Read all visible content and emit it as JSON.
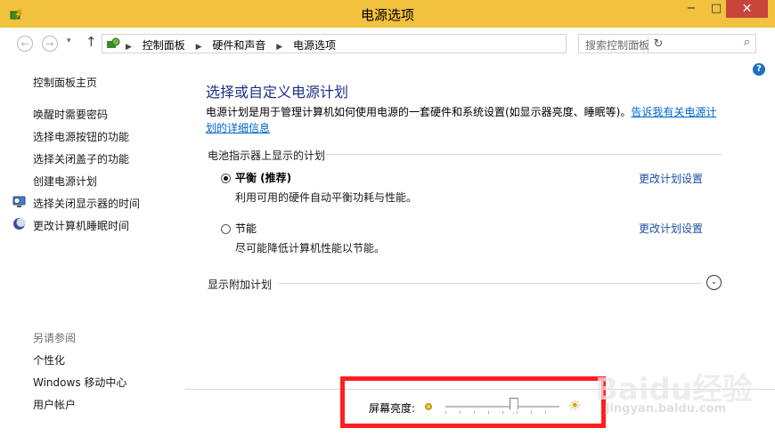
{
  "window": {
    "title": "电源选项",
    "buttons": {
      "minimize": "−",
      "maximize": "□",
      "close": "✕"
    }
  },
  "address_bar": {
    "back_icon": "back-arrow-icon",
    "forward_icon": "forward-arrow-icon",
    "breadcrumbs": [
      "控制面板",
      "硬件和声音",
      "电源选项"
    ],
    "search_placeholder": "搜索控制面板"
  },
  "sidebar": {
    "links": [
      {
        "label": "控制面板主页"
      },
      {
        "label": "唤醒时需要密码"
      },
      {
        "label": "选择电源按钮的功能"
      },
      {
        "label": "选择关闭盖子的功能"
      },
      {
        "label": "创建电源计划"
      },
      {
        "label": "选择关闭显示器的时间",
        "icon": "monitor-icon"
      },
      {
        "label": "更改计算机睡眠时间",
        "icon": "moon-icon"
      }
    ],
    "see_also_heading": "另请参阅",
    "see_also": [
      {
        "label": "个性化"
      },
      {
        "label": "Windows 移动中心"
      },
      {
        "label": "用户帐户"
      }
    ]
  },
  "main": {
    "heading": "选择或自定义电源计划",
    "description": "电源计划是用于管理计算机如何使用电源的一套硬件和系统设置(如显示器亮度、睡眠等)。",
    "description_link": "告诉我有关电源计划的详细信息",
    "group_title": "电池指示器上显示的计划",
    "plans": [
      {
        "name": "平衡 (推荐)",
        "description": "利用可用的硬件自动平衡功耗与性能。",
        "selected": true,
        "change_link": "更改计划设置"
      },
      {
        "name": "节能",
        "description": "尽可能降低计算机性能以节能。",
        "selected": false,
        "change_link": "更改计划设置"
      }
    ],
    "additional_plans_label": "显示附加计划"
  },
  "brightness": {
    "label": "屏幕亮度:",
    "level_fraction": 0.6,
    "highlight_color": "#ff1f1f"
  },
  "watermark": {
    "text": "Baidu经验",
    "sub": "jingyan.baidu.com"
  },
  "colors": {
    "titlebar": "#f2c13d",
    "heading": "#1e3287",
    "link": "#1e4fa8",
    "close_button": "#c7453a"
  }
}
